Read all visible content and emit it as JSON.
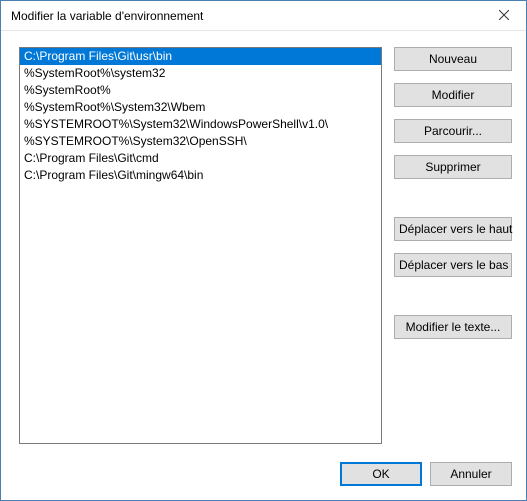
{
  "window": {
    "title": "Modifier la variable d'environnement"
  },
  "list": {
    "selected_index": 0,
    "items": [
      "C:\\Program Files\\Git\\usr\\bin",
      "%SystemRoot%\\system32",
      "%SystemRoot%",
      "%SystemRoot%\\System32\\Wbem",
      "%SYSTEMROOT%\\System32\\WindowsPowerShell\\v1.0\\",
      "%SYSTEMROOT%\\System32\\OpenSSH\\",
      "C:\\Program Files\\Git\\cmd",
      "C:\\Program Files\\Git\\mingw64\\bin"
    ]
  },
  "buttons": {
    "new": "Nouveau",
    "edit": "Modifier",
    "browse": "Parcourir...",
    "delete": "Supprimer",
    "move_up": "Déplacer vers le haut",
    "move_down": "Déplacer vers le bas",
    "edit_text": "Modifier le texte..."
  },
  "footer": {
    "ok": "OK",
    "cancel": "Annuler"
  }
}
